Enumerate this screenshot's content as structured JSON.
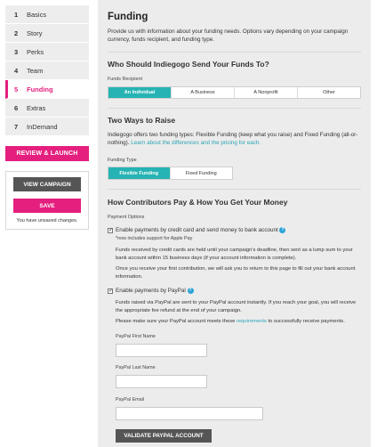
{
  "sidebar": {
    "items": [
      {
        "num": "1",
        "label": "Basics"
      },
      {
        "num": "2",
        "label": "Story"
      },
      {
        "num": "3",
        "label": "Perks"
      },
      {
        "num": "4",
        "label": "Team"
      },
      {
        "num": "5",
        "label": "Funding"
      },
      {
        "num": "6",
        "label": "Extras"
      },
      {
        "num": "7",
        "label": "InDemand"
      }
    ],
    "active_index": 4,
    "review_label": "REVIEW & LAUNCH",
    "view_campaign_label": "VIEW CAMPAIGN",
    "save_label": "SAVE",
    "unsaved_text": "You have unsaved changes."
  },
  "main": {
    "title": "Funding",
    "intro": "Provide us with information about your funding needs. Options vary depending on your campaign currency, funds recipient, and funding type.",
    "recipient": {
      "heading": "Who Should Indiegogo Send Your Funds To?",
      "label": "Funds Recipient",
      "options": [
        "An Individual",
        "A Business",
        "A Nonprofit",
        "Other"
      ],
      "selected": "An Individual"
    },
    "raise": {
      "heading": "Two Ways to Raise",
      "text": "Indiegogo offers two funding types: Flexible Funding (keep what you raise) and Fixed Funding (all-or-nothing).",
      "link": "Learn about the differences and the pricing for each.",
      "label": "Funding Type",
      "options": [
        "Flexible Funding",
        "Fixed Funding"
      ],
      "selected": "Flexible Funding"
    },
    "payment": {
      "heading": "How Contributors Pay & How You Get Your Money",
      "label": "Payment Options",
      "card_option": "Enable payments by credit card and send money to bank account",
      "card_sub": "*now includes support for Apple Pay",
      "card_p1": "Funds received by credit cards are held until your campaign's deadline, then sent as a lump sum to your bank account within 15 business days (if your account information is complete).",
      "card_p2": "Once you receive your first contribution, we will ask you to return to this page to fill out your bank account information.",
      "paypal_option": "Enable payments by PayPal",
      "paypal_p1": "Funds raised via PayPal are sent to your PayPal account instantly. If you reach your goal, you will receive the appropriate fee refund at the end of your campaign.",
      "paypal_p2_pre": "Please make sure your PayPal account meets these",
      "paypal_p2_link": "requirements",
      "paypal_p2_post": "to successfully receive payments.",
      "first_name_label": "PayPal First Name",
      "last_name_label": "PayPal Last Name",
      "email_label": "PayPal Email",
      "first_name_value": "",
      "last_name_value": "",
      "email_value": "",
      "validate_label": "VALIDATE PAYPAL ACCOUNT"
    }
  },
  "colors": {
    "accent_pink": "#e51f7e",
    "accent_teal": "#27b3b3",
    "link": "#2aa3b5"
  }
}
